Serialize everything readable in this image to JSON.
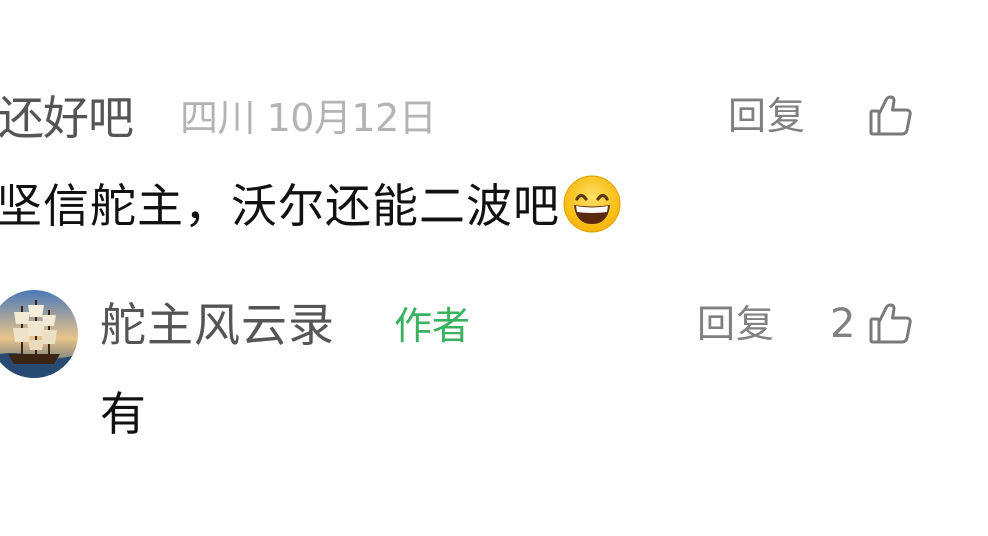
{
  "comment": {
    "username": "还好吧",
    "meta": "四川 10月12日",
    "reply_label": "回复",
    "text": "坚信舵主，沃尔还能二波吧",
    "emoji_icon": "grinning-face-emoji",
    "like_icon": "thumbs-up-icon"
  },
  "reply_comment": {
    "avatar_icon": "sailing-ship-avatar",
    "username": "舵主风云录",
    "author_tag": "作者",
    "reply_label": "回复",
    "like_count": "2",
    "text": "有",
    "like_icon": "thumbs-up-icon"
  },
  "colors": {
    "username": "#555555",
    "meta": "#b3b3b3",
    "reply": "#808080",
    "author_tag": "#38b25f",
    "text": "#111111"
  }
}
